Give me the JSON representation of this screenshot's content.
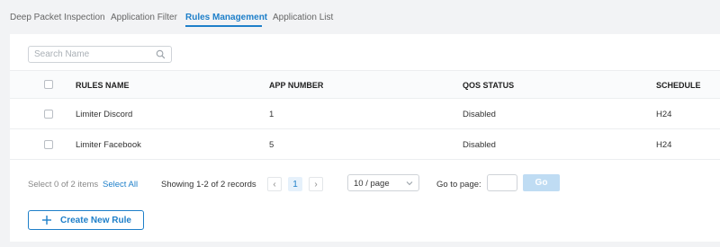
{
  "tabs": [
    {
      "label": "Deep Packet Inspection",
      "active": false
    },
    {
      "label": "Application Filter",
      "active": false
    },
    {
      "label": "Rules Management",
      "active": true
    },
    {
      "label": "Application List",
      "active": false
    }
  ],
  "search": {
    "placeholder": "Search Name",
    "value": "",
    "icon": "search-icon"
  },
  "table": {
    "headers": {
      "rules_name": "RULES NAME",
      "app_number": "APP NUMBER",
      "qos_status": "QOS STATUS",
      "schedule": "SCHEDULE"
    },
    "rows": [
      {
        "rules_name": "Limiter Discord",
        "app_number": "1",
        "qos_status": "Disabled",
        "schedule": "H24"
      },
      {
        "rules_name": "Limiter Facebook",
        "app_number": "5",
        "qos_status": "Disabled",
        "schedule": "H24"
      }
    ]
  },
  "footer": {
    "selected_text": "Select 0 of 2 items",
    "select_all": "Select All",
    "showing": "Showing 1-2 of 2 records",
    "prev": "‹",
    "current_page": "1",
    "next": "›",
    "page_size": "10 / page",
    "goto_label": "Go to page:",
    "goto_value": "",
    "go_label": "Go"
  },
  "create_button": {
    "label": "Create New Rule",
    "icon": "plus-icon"
  },
  "colors": {
    "accent": "#1e7fc9",
    "go_disabled": "#bfdcf3",
    "background": "#f2f3f5"
  }
}
